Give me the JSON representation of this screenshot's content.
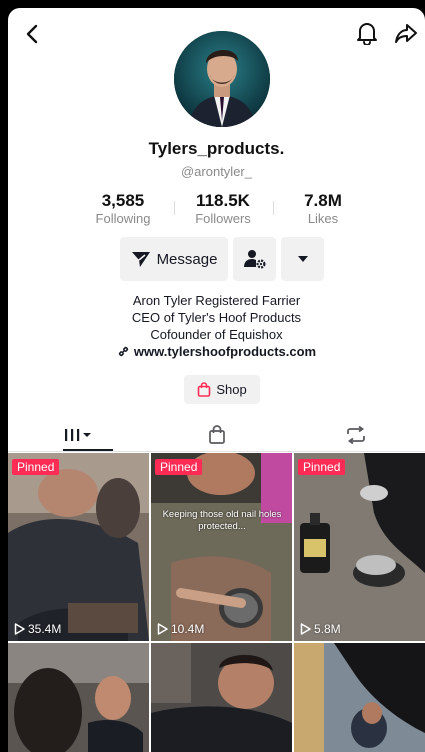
{
  "profile": {
    "username": "Tylers_products.",
    "handle": "@arontyler_"
  },
  "stats": [
    {
      "value": "3,585",
      "label": "Following"
    },
    {
      "value": "118.5K",
      "label": "Followers"
    },
    {
      "value": "7.8M",
      "label": "Likes"
    }
  ],
  "actions": {
    "message_label": "Message"
  },
  "bio": {
    "lines": [
      "Aron Tyler Registered Farrier",
      "CEO of Tyler's Hoof Products",
      "Cofounder of Equishox"
    ],
    "link": "www.tylershoofproducts.com"
  },
  "shop": {
    "label": "Shop"
  },
  "videos": [
    {
      "pinned": "Pinned",
      "views": "35.4M",
      "caption": ""
    },
    {
      "pinned": "Pinned",
      "views": "10.4M",
      "caption": "Keeping those old nail holes protected..."
    },
    {
      "pinned": "Pinned",
      "views": "5.8M",
      "caption": ""
    },
    {
      "pinned": "",
      "views": "",
      "caption": ""
    },
    {
      "pinned": "",
      "views": "",
      "caption": ""
    },
    {
      "pinned": "",
      "views": "",
      "caption": ""
    }
  ],
  "colors": {
    "accent": "#fe2c55",
    "button_bg": "#f1f1f2",
    "text": "#161823",
    "muted": "#8a8a8a"
  }
}
